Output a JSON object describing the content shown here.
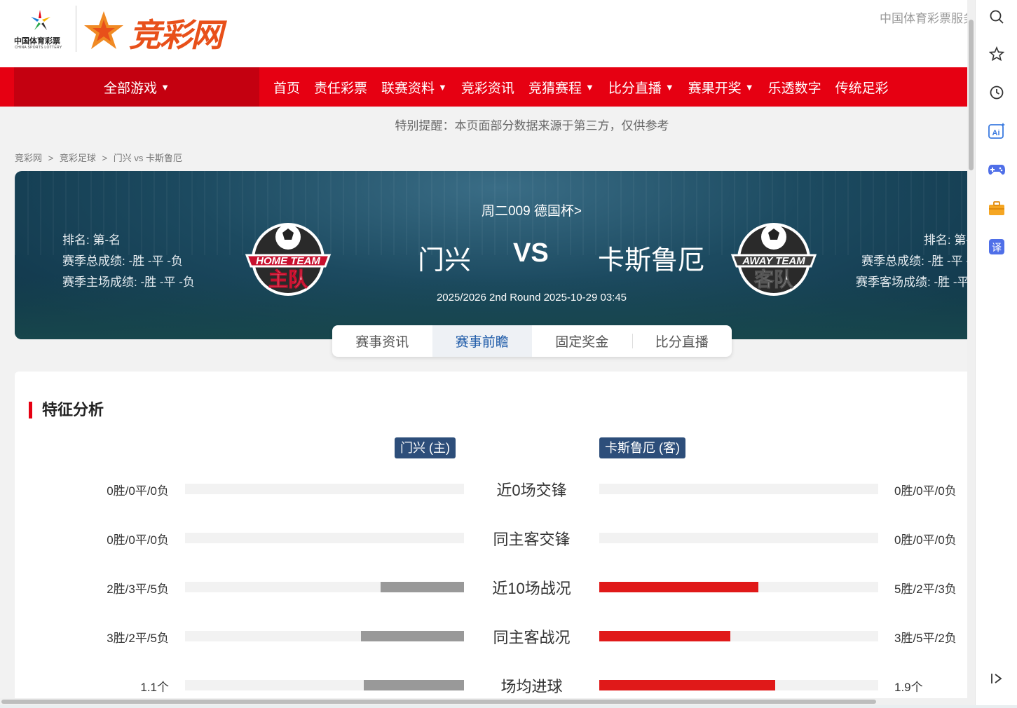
{
  "header": {
    "lottery_logo_text": "中国体育彩票",
    "lottery_logo_en": "CHINA SPORTS LOTTERY",
    "site_logo_text": "竞彩网",
    "service_link": "中国体育彩票服务"
  },
  "nav": {
    "all_games": "全部游戏",
    "items": [
      {
        "label": "首页"
      },
      {
        "label": "责任彩票"
      },
      {
        "label": "联赛资料",
        "dropdown": true
      },
      {
        "label": "竞彩资讯"
      },
      {
        "label": "竞猜赛程",
        "dropdown": true
      },
      {
        "label": "比分直播",
        "dropdown": true
      },
      {
        "label": "赛果开奖",
        "dropdown": true
      },
      {
        "label": "乐透数字"
      },
      {
        "label": "传统足彩"
      }
    ]
  },
  "notice": "特别提醒：本页面部分数据来源于第三方，仅供参考",
  "breadcrumb": [
    "竞彩网",
    ">",
    "竞彩足球",
    ">",
    "门兴 vs 卡斯鲁厄"
  ],
  "match": {
    "title": "周二009 德国杯>",
    "home": {
      "name": "门兴",
      "logo_text_top": "HOME TEAM",
      "logo_text_bottom": "主队",
      "rank": "排名: 第-名",
      "season_record": "赛季总成绩: -胜 -平 -负",
      "venue_record": "赛季主场成绩: -胜 -平 -负"
    },
    "vs": "VS",
    "away": {
      "name": "卡斯鲁厄",
      "logo_text_top": "AWAY TEAM",
      "logo_text_bottom": "客队",
      "rank": "排名: 第-名",
      "season_record": "赛季总成绩: -胜 -平 -负",
      "venue_record": "赛季客场成绩: -胜 -平 -负"
    },
    "info": "2025/2026 2nd Round 2025-10-29 03:45"
  },
  "tabs": [
    {
      "label": "赛事资讯",
      "active": false
    },
    {
      "label": "赛事前瞻",
      "active": true
    },
    {
      "label": "固定奖金",
      "active": false
    },
    {
      "label": "比分直播",
      "active": false
    }
  ],
  "analysis": {
    "title": "特征分析",
    "home_badge": "门兴 (主)",
    "away_badge": "卡斯鲁厄 (客)",
    "rows": [
      {
        "label": "近0场交锋",
        "home_value": "0胜/0平/0负",
        "away_value": "0胜/0平/0负",
        "home_fill": 0,
        "away_fill": 0
      },
      {
        "label": "同主客交锋",
        "home_value": "0胜/0平/0负",
        "away_value": "0胜/0平/0负",
        "home_fill": 0,
        "away_fill": 0
      },
      {
        "label": "近10场战况",
        "home_value": "2胜/3平/5负",
        "away_value": "5胜/2平/3负",
        "home_fill": 0.3,
        "away_fill": 0.57
      },
      {
        "label": "同主客战况",
        "home_value": "3胜/2平/5负",
        "away_value": "3胜/5平/2负",
        "home_fill": 0.37,
        "away_fill": 0.47
      },
      {
        "label": "场均进球",
        "home_value": "1.1个",
        "away_value": "1.9个",
        "home_fill": 0.36,
        "away_fill": 0.63
      }
    ]
  },
  "sidebar": {
    "icons": [
      "search-icon",
      "star-icon",
      "history-icon",
      "ai-icon",
      "game-icon",
      "briefcase-icon",
      "translate-icon",
      "collapse-icon"
    ],
    "ai_label": "Ai",
    "translate_label": "译"
  },
  "colors": {
    "nav_red": "#e60012",
    "nav_dark_red": "#c40010",
    "badge_blue": "#2d4e7a",
    "active_tab_text": "#1d5aa8",
    "away_bar": "#e01919",
    "home_bar": "#999999"
  }
}
